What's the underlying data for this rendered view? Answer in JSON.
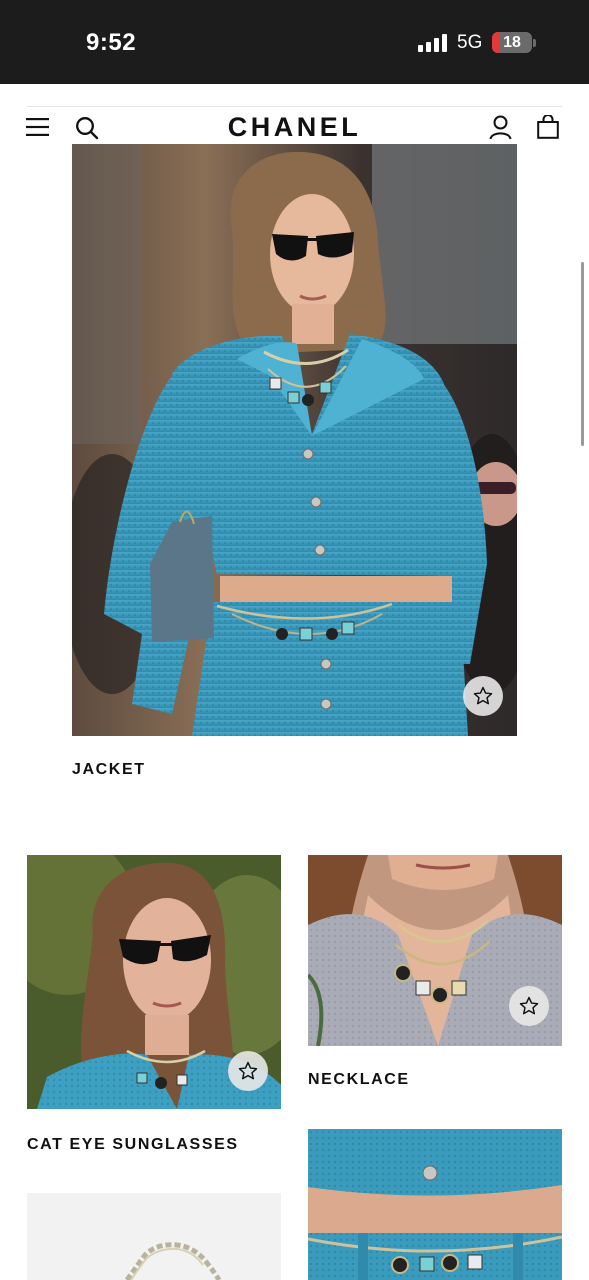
{
  "status_bar": {
    "time": "9:52",
    "network": "5G",
    "battery": "18",
    "battery_level": 0.18,
    "signal_bars": 4
  },
  "header": {
    "logo": "CHANEL",
    "icons": [
      "menu-icon",
      "search-icon",
      "account-icon",
      "bag-icon"
    ]
  },
  "products": [
    {
      "label": "JACKET"
    },
    {
      "label": "CAT EYE SUNGLASSES"
    },
    {
      "label": "NECKLACE"
    },
    {
      "label": ""
    },
    {
      "label": ""
    }
  ],
  "colors": {
    "jacket_blue": "#3a9bbd",
    "status_bar": "#1c1c1c",
    "battery_red": "#e5383b"
  }
}
